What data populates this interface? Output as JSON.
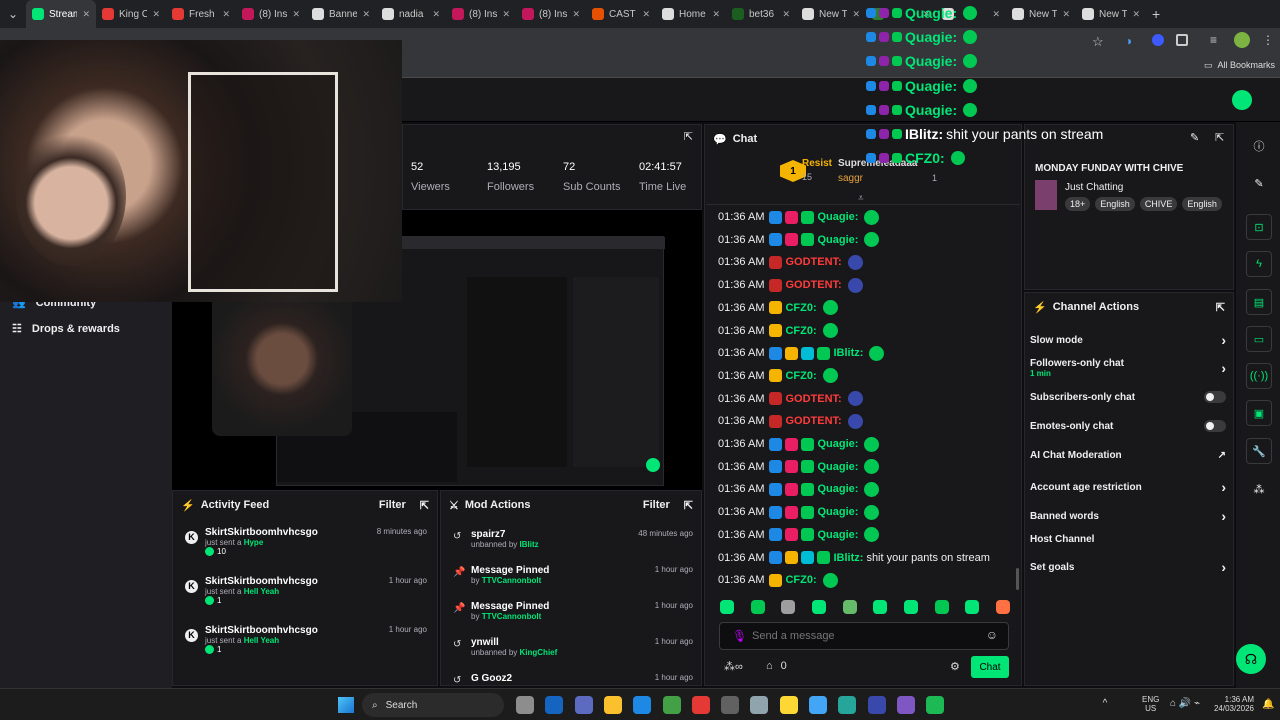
{
  "browser": {
    "tabs": [
      {
        "label": "Stream",
        "color": "#00e676",
        "active": true
      },
      {
        "label": "King C",
        "color": "#e53935"
      },
      {
        "label": "Fresh",
        "color": "#e53935"
      },
      {
        "label": "(8) Ins",
        "color": "#c2185b"
      },
      {
        "label": "Banne",
        "color": "#ddd"
      },
      {
        "label": "nadia",
        "color": "#ddd"
      },
      {
        "label": "(8) Ins",
        "color": "#c2185b"
      },
      {
        "label": "(8) Ins",
        "color": "#c2185b"
      },
      {
        "label": "CAST",
        "color": "#e65100"
      },
      {
        "label": "Home",
        "color": "#ddd"
      },
      {
        "label": "bet36",
        "color": "#1b5e20"
      },
      {
        "label": "New T",
        "color": "#ddd"
      },
      {
        "label": "",
        "color": "#2e7d32"
      },
      {
        "label": "",
        "color": "#ddd"
      },
      {
        "label": "New T",
        "color": "#ddd"
      },
      {
        "label": "New T",
        "color": "#ddd"
      }
    ],
    "all_bookmarks": "All Bookmarks"
  },
  "stats": [
    {
      "value": "52",
      "label": "Viewers"
    },
    {
      "value": "13,195",
      "label": "Followers"
    },
    {
      "value": "72",
      "label": "Sub Counts"
    },
    {
      "value": "02:41:57",
      "label": "Time Live"
    }
  ],
  "left_nav": {
    "community": "Community",
    "drops": "Drops & rewards"
  },
  "chat": {
    "title": "Chat",
    "leaderboard": [
      {
        "rank": "1",
        "name": "Resist",
        "count": "15"
      },
      {
        "name": "Supremeleadaaa",
        "count": ""
      },
      {
        "name": "saggr",
        "count": "1"
      }
    ],
    "messages": [
      {
        "time": "01:36 AM",
        "user": "Quagie:",
        "color": "#00e676",
        "text": ""
      },
      {
        "time": "01:36 AM",
        "user": "Quagie:",
        "color": "#00e676",
        "text": ""
      },
      {
        "time": "01:36 AM",
        "user": "GODTENT:",
        "color": "#ff3b3b",
        "text": ""
      },
      {
        "time": "01:36 AM",
        "user": "GODTENT:",
        "color": "#ff3b3b",
        "text": ""
      },
      {
        "time": "01:36 AM",
        "user": "CFZ0:",
        "color": "#00e676",
        "text": ""
      },
      {
        "time": "01:36 AM",
        "user": "CFZ0:",
        "color": "#00e676",
        "text": ""
      },
      {
        "time": "01:36 AM",
        "user": "IBlitz:",
        "color": "#00e676",
        "text": ""
      },
      {
        "time": "01:36 AM",
        "user": "CFZ0:",
        "color": "#00e676",
        "text": ""
      },
      {
        "time": "01:36 AM",
        "user": "GODTENT:",
        "color": "#ff3b3b",
        "text": ""
      },
      {
        "time": "01:36 AM",
        "user": "GODTENT:",
        "color": "#ff3b3b",
        "text": ""
      },
      {
        "time": "01:36 AM",
        "user": "Quagie:",
        "color": "#00e676",
        "text": ""
      },
      {
        "time": "01:36 AM",
        "user": "Quagie:",
        "color": "#00e676",
        "text": ""
      },
      {
        "time": "01:36 AM",
        "user": "Quagie:",
        "color": "#00e676",
        "text": ""
      },
      {
        "time": "01:36 AM",
        "user": "Quagie:",
        "color": "#00e676",
        "text": ""
      },
      {
        "time": "01:36 AM",
        "user": "Quagie:",
        "color": "#00e676",
        "text": ""
      },
      {
        "time": "01:36 AM",
        "user": "IBlitz:",
        "color": "#00e676",
        "text": "shit your pants on stream"
      },
      {
        "time": "01:36 AM",
        "user": "CFZ0:",
        "color": "#00e676",
        "text": ""
      }
    ],
    "placeholder": "Send a message",
    "points": "0",
    "chat_button": "Chat"
  },
  "overlay_chat": [
    {
      "user": "Quagie:",
      "text": ""
    },
    {
      "user": "Quagie:",
      "text": ""
    },
    {
      "user": "Quagie:",
      "text": ""
    },
    {
      "user": "Quagie:",
      "text": ""
    },
    {
      "user": "Quagie:",
      "text": ""
    },
    {
      "user": "IBlitz:",
      "text": "shit your pants on stream"
    },
    {
      "user": "CFZ0:",
      "text": ""
    }
  ],
  "stream_info": {
    "title": "MONDAY FUNDAY WITH CHIVE",
    "category": "Just Chatting",
    "tags": [
      "18+",
      "English",
      "CHIVE",
      "English"
    ]
  },
  "channel_actions": {
    "title": "Channel Actions",
    "items": [
      {
        "label": "Slow mode",
        "sub": "",
        "kind": "chevron"
      },
      {
        "label": "Followers-only chat",
        "sub": "1 min",
        "kind": "chevron"
      },
      {
        "label": "Subscribers-only chat",
        "sub": "",
        "kind": "toggle"
      },
      {
        "label": "Emotes-only chat",
        "sub": "",
        "kind": "toggle"
      },
      {
        "label": "AI Chat Moderation",
        "sub": "",
        "kind": "external"
      },
      {
        "label": "Account age restriction",
        "sub": "",
        "kind": "chevron"
      },
      {
        "label": "Banned words",
        "sub": "",
        "kind": "chevron"
      },
      {
        "label": "Host Channel",
        "sub": "",
        "kind": "none"
      },
      {
        "label": "Set goals",
        "sub": "",
        "kind": "chevron"
      }
    ]
  },
  "activity_feed": {
    "title": "Activity Feed",
    "filter": "Filter",
    "items": [
      {
        "user": "SkirtSkirtboomhvhcsgo",
        "action": "just sent a",
        "gift": "Hype",
        "amount": "10",
        "time": "8 minutes ago"
      },
      {
        "user": "SkirtSkirtboomhvhcsgo",
        "action": "just sent a",
        "gift": "Hell Yeah",
        "amount": "1",
        "time": "1 hour ago"
      },
      {
        "user": "SkirtSkirtboomhvhcsgo",
        "action": "just sent a",
        "gift": "Hell Yeah",
        "amount": "1",
        "time": "1 hour ago"
      }
    ]
  },
  "mod_actions": {
    "title": "Mod Actions",
    "filter": "Filter",
    "items": [
      {
        "title": "spairz7",
        "sub_pre": "unbanned by",
        "by": "IBlitz",
        "time": "48 minutes ago"
      },
      {
        "title": "Message Pinned",
        "sub_pre": "by",
        "by": "TTVCannonbolt",
        "time": "1 hour ago"
      },
      {
        "title": "Message Pinned",
        "sub_pre": "by",
        "by": "TTVCannonbolt",
        "time": "1 hour ago"
      },
      {
        "title": "ynwill",
        "sub_pre": "unbanned by",
        "by": "KingChief",
        "time": "1 hour ago"
      },
      {
        "title": "G Gooz2",
        "sub_pre": "",
        "by": "",
        "time": "1 hour ago"
      }
    ]
  },
  "taskbar": {
    "search": "Search",
    "lang": "ENG",
    "region": "US",
    "time": "1:36 AM",
    "date": "24/03/2026"
  },
  "colors": {
    "accent": "#00e676",
    "bg": "#0e0e10",
    "panel": "#18181b"
  }
}
